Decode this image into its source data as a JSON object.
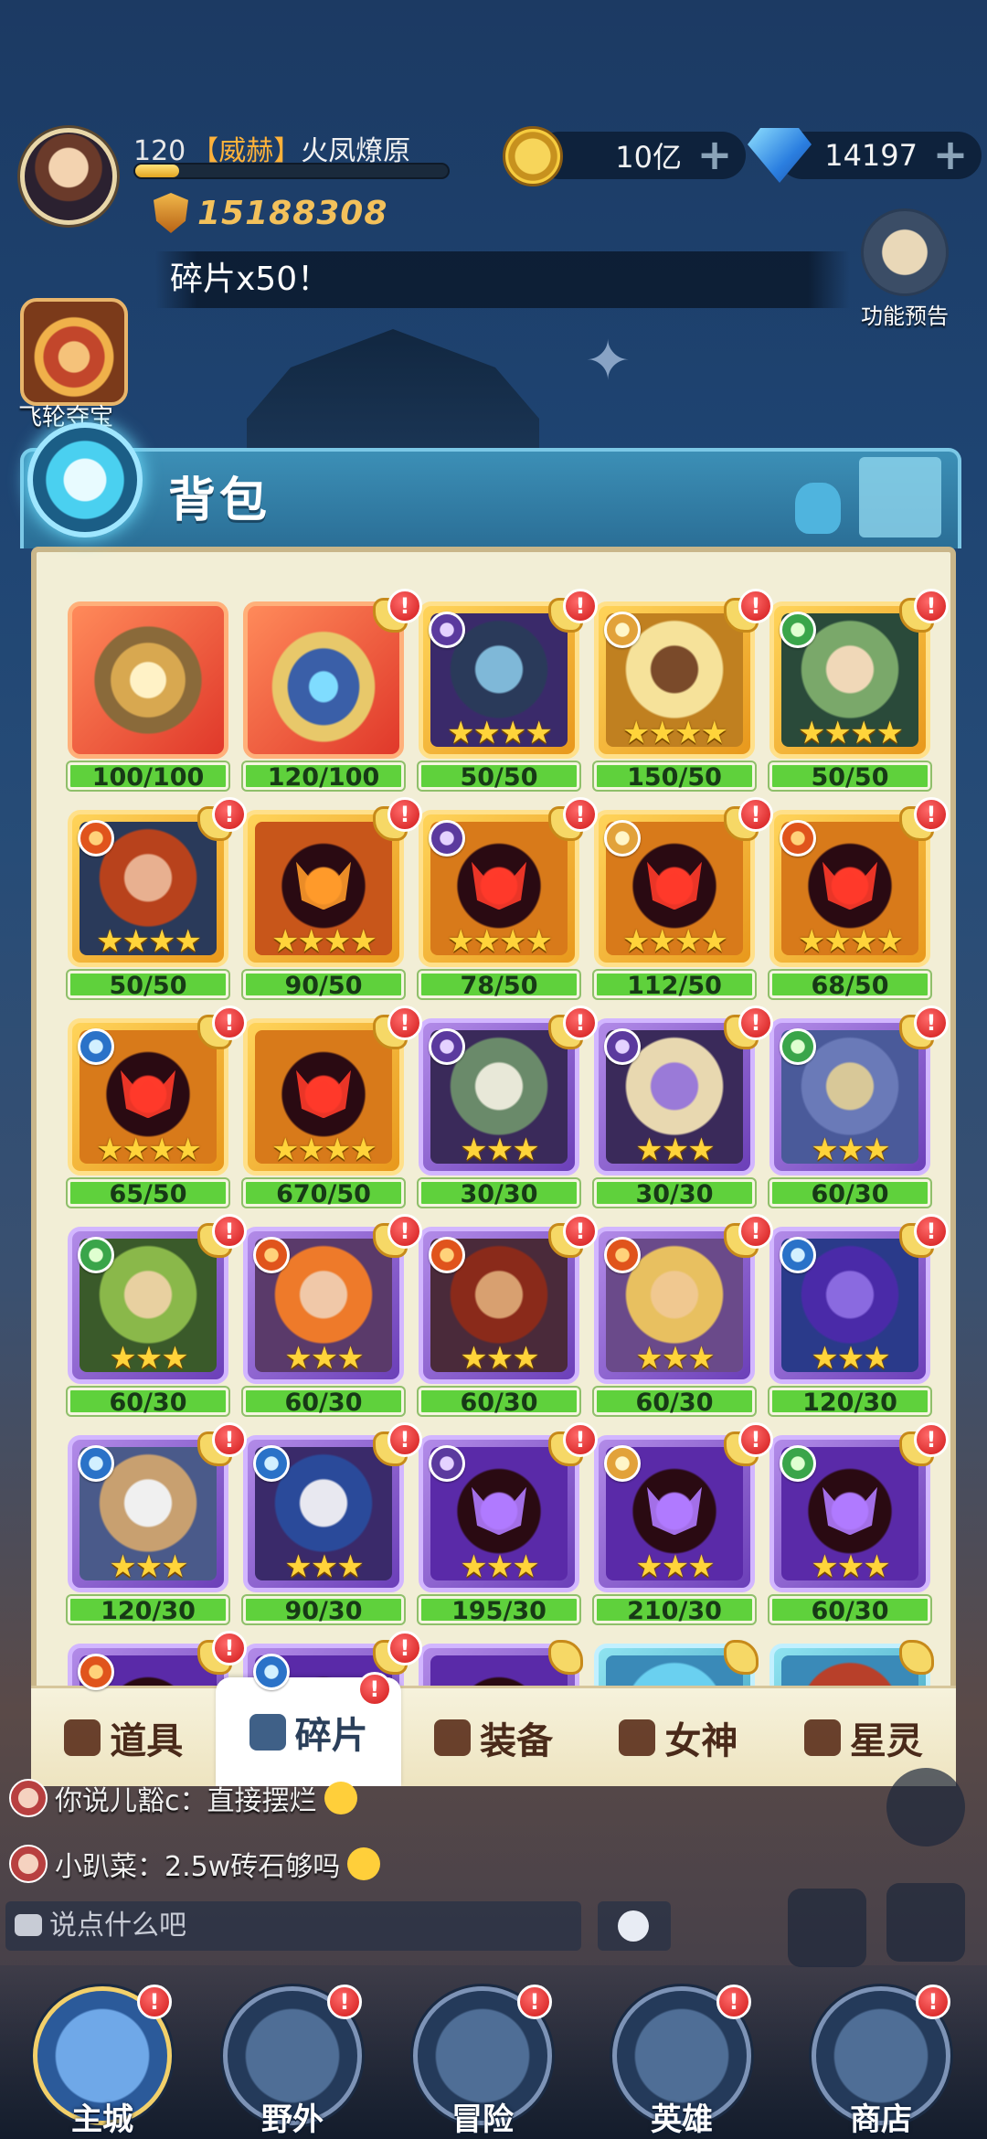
{
  "player": {
    "level": "120",
    "tag": "【威赫】",
    "name": "火凤燎原",
    "power": "15188308",
    "xp_fraction": 0.14
  },
  "resources": {
    "gold": "10亿",
    "diamonds": "14197",
    "plus": "+"
  },
  "notice": "碎片x50！",
  "side": {
    "preview_label": "功能预告",
    "feilun_label": "飞轮夺宝"
  },
  "bag": {
    "title": "背包",
    "items": [
      {
        "frame": "red",
        "art": "item-book",
        "count": "100/100",
        "stars": "",
        "element": null,
        "alert": false
      },
      {
        "frame": "red",
        "art": "item-chest",
        "count": "120/100",
        "stars": "",
        "element": null,
        "alert": true
      },
      {
        "frame": "gold",
        "art": "hero",
        "skin": "#7fb8d8",
        "hair": "#2a3a5a",
        "bg": "#3a2a6a",
        "count": "50/50",
        "stars": "★★★★",
        "element": "dark",
        "alert": true
      },
      {
        "frame": "gold",
        "art": "hero",
        "skin": "#7a4a2a",
        "hair": "#f6e29a",
        "bg": "#c08020",
        "count": "150/50",
        "stars": "★★★★",
        "element": "light",
        "alert": true
      },
      {
        "frame": "gold",
        "art": "hero",
        "skin": "#f0d8b8",
        "hair": "#7aa86a",
        "bg": "#2a4a3a",
        "count": "50/50",
        "stars": "★★★★",
        "element": "wind",
        "alert": true
      },
      {
        "frame": "gold",
        "art": "hero",
        "skin": "#e8b090",
        "hair": "#b8421c",
        "bg": "#2a3a5a",
        "count": "50/50",
        "stars": "★★★★",
        "element": "fire",
        "alert": true
      },
      {
        "frame": "gold",
        "art": "silhouette",
        "glow": "#ff9a2a",
        "bg": "#c8561a",
        "count": "90/50",
        "stars": "★★★★",
        "element": null,
        "alert": true
      },
      {
        "frame": "gold",
        "art": "silhouette",
        "glow": "#ff3a2a",
        "bg": "#d87a1a",
        "count": "78/50",
        "stars": "★★★★",
        "element": "dark",
        "alert": true
      },
      {
        "frame": "gold",
        "art": "silhouette",
        "glow": "#ff3a2a",
        "bg": "#d87a1a",
        "count": "112/50",
        "stars": "★★★★",
        "element": "light",
        "alert": true
      },
      {
        "frame": "gold",
        "art": "silhouette",
        "glow": "#ff3a2a",
        "bg": "#d87a1a",
        "count": "68/50",
        "stars": "★★★★",
        "element": "fire",
        "alert": true
      },
      {
        "frame": "gold",
        "art": "silhouette",
        "glow": "#ff3a2a",
        "bg": "#d87a1a",
        "count": "65/50",
        "stars": "★★★★",
        "element": "water",
        "alert": true
      },
      {
        "frame": "gold",
        "art": "silhouette",
        "glow": "#ff3a2a",
        "bg": "#d87a1a",
        "count": "670/50",
        "stars": "★★★★",
        "element": null,
        "alert": true
      },
      {
        "frame": "purple",
        "art": "hero",
        "skin": "#e8e8d8",
        "hair": "#6a8a6a",
        "bg": "#3a2a5a",
        "count": "30/30",
        "stars": "★★★",
        "element": "dark",
        "alert": true
      },
      {
        "frame": "purple",
        "art": "hero",
        "skin": "#9a7ad8",
        "hair": "#e8d8b0",
        "bg": "#3a2a5a",
        "count": "30/30",
        "stars": "★★★",
        "element": "dark",
        "alert": true
      },
      {
        "frame": "purple",
        "art": "hero",
        "skin": "#d8c898",
        "hair": "#6a7ab8",
        "bg": "#4a5a9a",
        "count": "60/30",
        "stars": "★★★",
        "element": "wind",
        "alert": true
      },
      {
        "frame": "purple",
        "art": "hero",
        "skin": "#e8d0a0",
        "hair": "#8ab84a",
        "bg": "#3a5a2a",
        "count": "60/30",
        "stars": "★★★",
        "element": "wind",
        "alert": true
      },
      {
        "frame": "purple",
        "art": "hero",
        "skin": "#f0c8a8",
        "hair": "#ee7a2a",
        "bg": "#5a3a6a",
        "count": "60/30",
        "stars": "★★★",
        "element": "fire",
        "alert": true
      },
      {
        "frame": "purple",
        "art": "hero",
        "skin": "#d8a070",
        "hair": "#8a2a1a",
        "bg": "#4a2a3a",
        "count": "60/30",
        "stars": "★★★",
        "element": "fire",
        "alert": true
      },
      {
        "frame": "purple",
        "art": "hero",
        "skin": "#f0c890",
        "hair": "#e8c060",
        "bg": "#6a4a8a",
        "count": "60/30",
        "stars": "★★★",
        "element": "fire",
        "alert": true
      },
      {
        "frame": "purple",
        "art": "hero",
        "skin": "#8a6ae0",
        "hair": "#4a2aa8",
        "bg": "#2a3a8a",
        "count": "120/30",
        "stars": "★★★",
        "element": "water",
        "alert": true
      },
      {
        "frame": "purple",
        "art": "hero",
        "skin": "#f0f0f0",
        "hair": "#c8a070",
        "bg": "#4a5a8a",
        "count": "120/30",
        "stars": "★★★",
        "element": "water",
        "alert": true
      },
      {
        "frame": "purple",
        "art": "hero",
        "skin": "#e8e8f0",
        "hair": "#2a4a9a",
        "bg": "#3a2a6a",
        "count": "90/30",
        "stars": "★★★",
        "element": "water",
        "alert": true
      },
      {
        "frame": "purple",
        "art": "silhouette",
        "glow": "#b07aff",
        "bg": "#5a2aa8",
        "count": "195/30",
        "stars": "★★★",
        "element": "dark",
        "alert": true
      },
      {
        "frame": "purple",
        "art": "silhouette",
        "glow": "#b07aff",
        "bg": "#5a2aa8",
        "count": "210/30",
        "stars": "★★★",
        "element": "light",
        "alert": true
      },
      {
        "frame": "purple",
        "art": "silhouette",
        "glow": "#b07aff",
        "bg": "#5a2aa8",
        "count": "60/30",
        "stars": "★★★",
        "element": "wind",
        "alert": true
      },
      {
        "frame": "purple",
        "art": "silhouette",
        "glow": "#b07aff",
        "bg": "#5a2aa8",
        "count": "",
        "stars": "",
        "element": "fire",
        "alert": true
      },
      {
        "frame": "purple",
        "art": "silhouette",
        "glow": "#b07aff",
        "bg": "#5a2aa8",
        "count": "",
        "stars": "",
        "element": "water",
        "alert": true
      },
      {
        "frame": "purple",
        "art": "silhouette",
        "glow": "#b07aff",
        "bg": "#5a2aa8",
        "count": "",
        "stars": "",
        "element": null,
        "alert": false
      },
      {
        "frame": "cyan",
        "art": "hero",
        "skin": "#e8f0f8",
        "hair": "#6ad0f0",
        "bg": "#3a8ab8",
        "count": "",
        "stars": "",
        "element": null,
        "alert": false
      },
      {
        "frame": "cyan",
        "art": "hero",
        "skin": "#d0e8f0",
        "hair": "#b8402a",
        "bg": "#3a8ab8",
        "count": "",
        "stars": "",
        "element": null,
        "alert": false
      }
    ]
  },
  "tabs": [
    {
      "label": "道具",
      "active": false,
      "alert": false
    },
    {
      "label": "碎片",
      "active": true,
      "alert": true
    },
    {
      "label": "装备",
      "active": false,
      "alert": false
    },
    {
      "label": "女神",
      "active": false,
      "alert": false
    },
    {
      "label": "星灵",
      "active": false,
      "alert": false
    }
  ],
  "chat": {
    "messages": [
      "你说儿豁c：直接摆烂",
      "小趴菜：2.5w砖石够吗"
    ],
    "placeholder": "说点什么吧"
  },
  "nav": [
    {
      "label": "主城",
      "active": true
    },
    {
      "label": "野外",
      "active": false
    },
    {
      "label": "冒险",
      "active": false
    },
    {
      "label": "英雄",
      "active": false
    },
    {
      "label": "商店",
      "active": false
    }
  ],
  "alert_mark": "!"
}
